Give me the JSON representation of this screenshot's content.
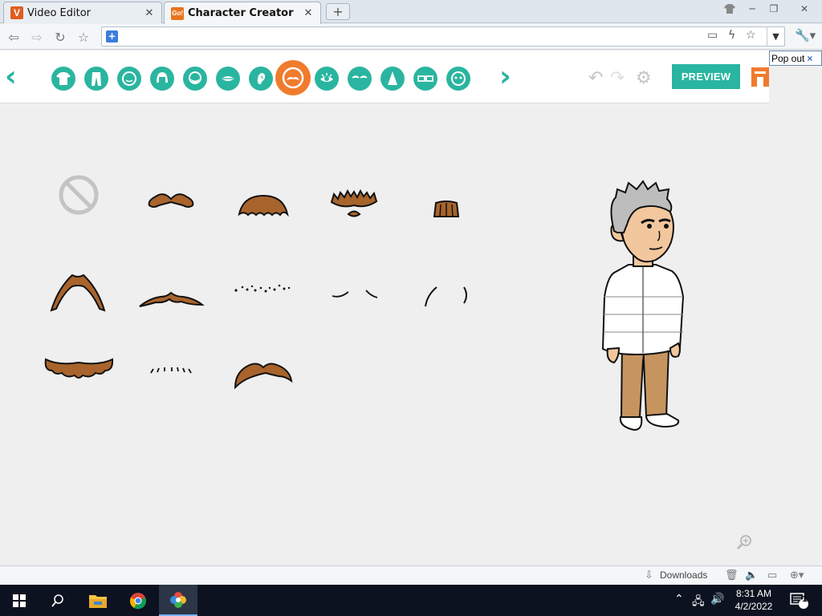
{
  "browser": {
    "tabs": [
      {
        "title": "Video Editor",
        "favicon_letter": "V",
        "favicon_color": "#e05d1f",
        "active": false
      },
      {
        "title": "Character Creator",
        "favicon_letter": "Go!",
        "favicon_color": "#e8741e",
        "active": true
      }
    ],
    "new_tab_label": "+",
    "window_controls": [
      "minimize-icon",
      "restore-icon",
      "close-icon"
    ],
    "address": "",
    "popout_label": "Pop out",
    "popout_close": "×"
  },
  "app": {
    "name": "Character Creator",
    "accent_color": "#2ab5a0",
    "active_color": "#f07b2d",
    "categories": [
      "shirt",
      "pants",
      "face",
      "hair",
      "beard",
      "mouth",
      "ear",
      "mustache",
      "eye",
      "eyebrow",
      "nose",
      "glasses",
      "accessory"
    ],
    "active_category": "mustache",
    "preview_label": "PREVIEW",
    "items": [
      {
        "name": "none"
      },
      {
        "name": "handlebar"
      },
      {
        "name": "walrus"
      },
      {
        "name": "bushy"
      },
      {
        "name": "soul-patch"
      },
      {
        "name": "horseshoe"
      },
      {
        "name": "pencil-thin"
      },
      {
        "name": "stubble-dots"
      },
      {
        "name": "light-curve"
      },
      {
        "name": "side-curves"
      },
      {
        "name": "wide-walrus"
      },
      {
        "name": "light-stubble"
      },
      {
        "name": "curled"
      }
    ]
  },
  "downloads": {
    "label": "Downloads"
  },
  "taskbar": {
    "time": "8:31 AM",
    "date": "4/2/2022",
    "notification_count": "1"
  }
}
